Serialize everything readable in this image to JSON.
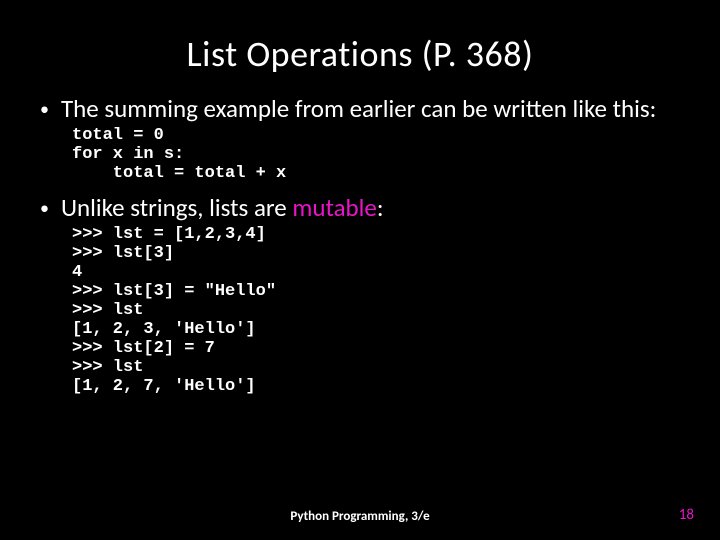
{
  "title": "List Operations (P. 368)",
  "bullets": [
    {
      "text": "The summing example from earlier can be written like this:",
      "code": "total = 0\nfor x in s:\n    total = total + x"
    },
    {
      "text_pre": "Unlike strings, lists are ",
      "text_hl": "mutable",
      "text_post": ":",
      "code": ">>> lst = [1,2,3,4]\n>>> lst[3]\n4\n>>> lst[3] = \"Hello\"\n>>> lst\n[1, 2, 3, 'Hello']\n>>> lst[2] = 7\n>>> lst\n[1, 2, 7, 'Hello']"
    }
  ],
  "footer_center": "Python Programming, 3/e",
  "footer_right": "18"
}
